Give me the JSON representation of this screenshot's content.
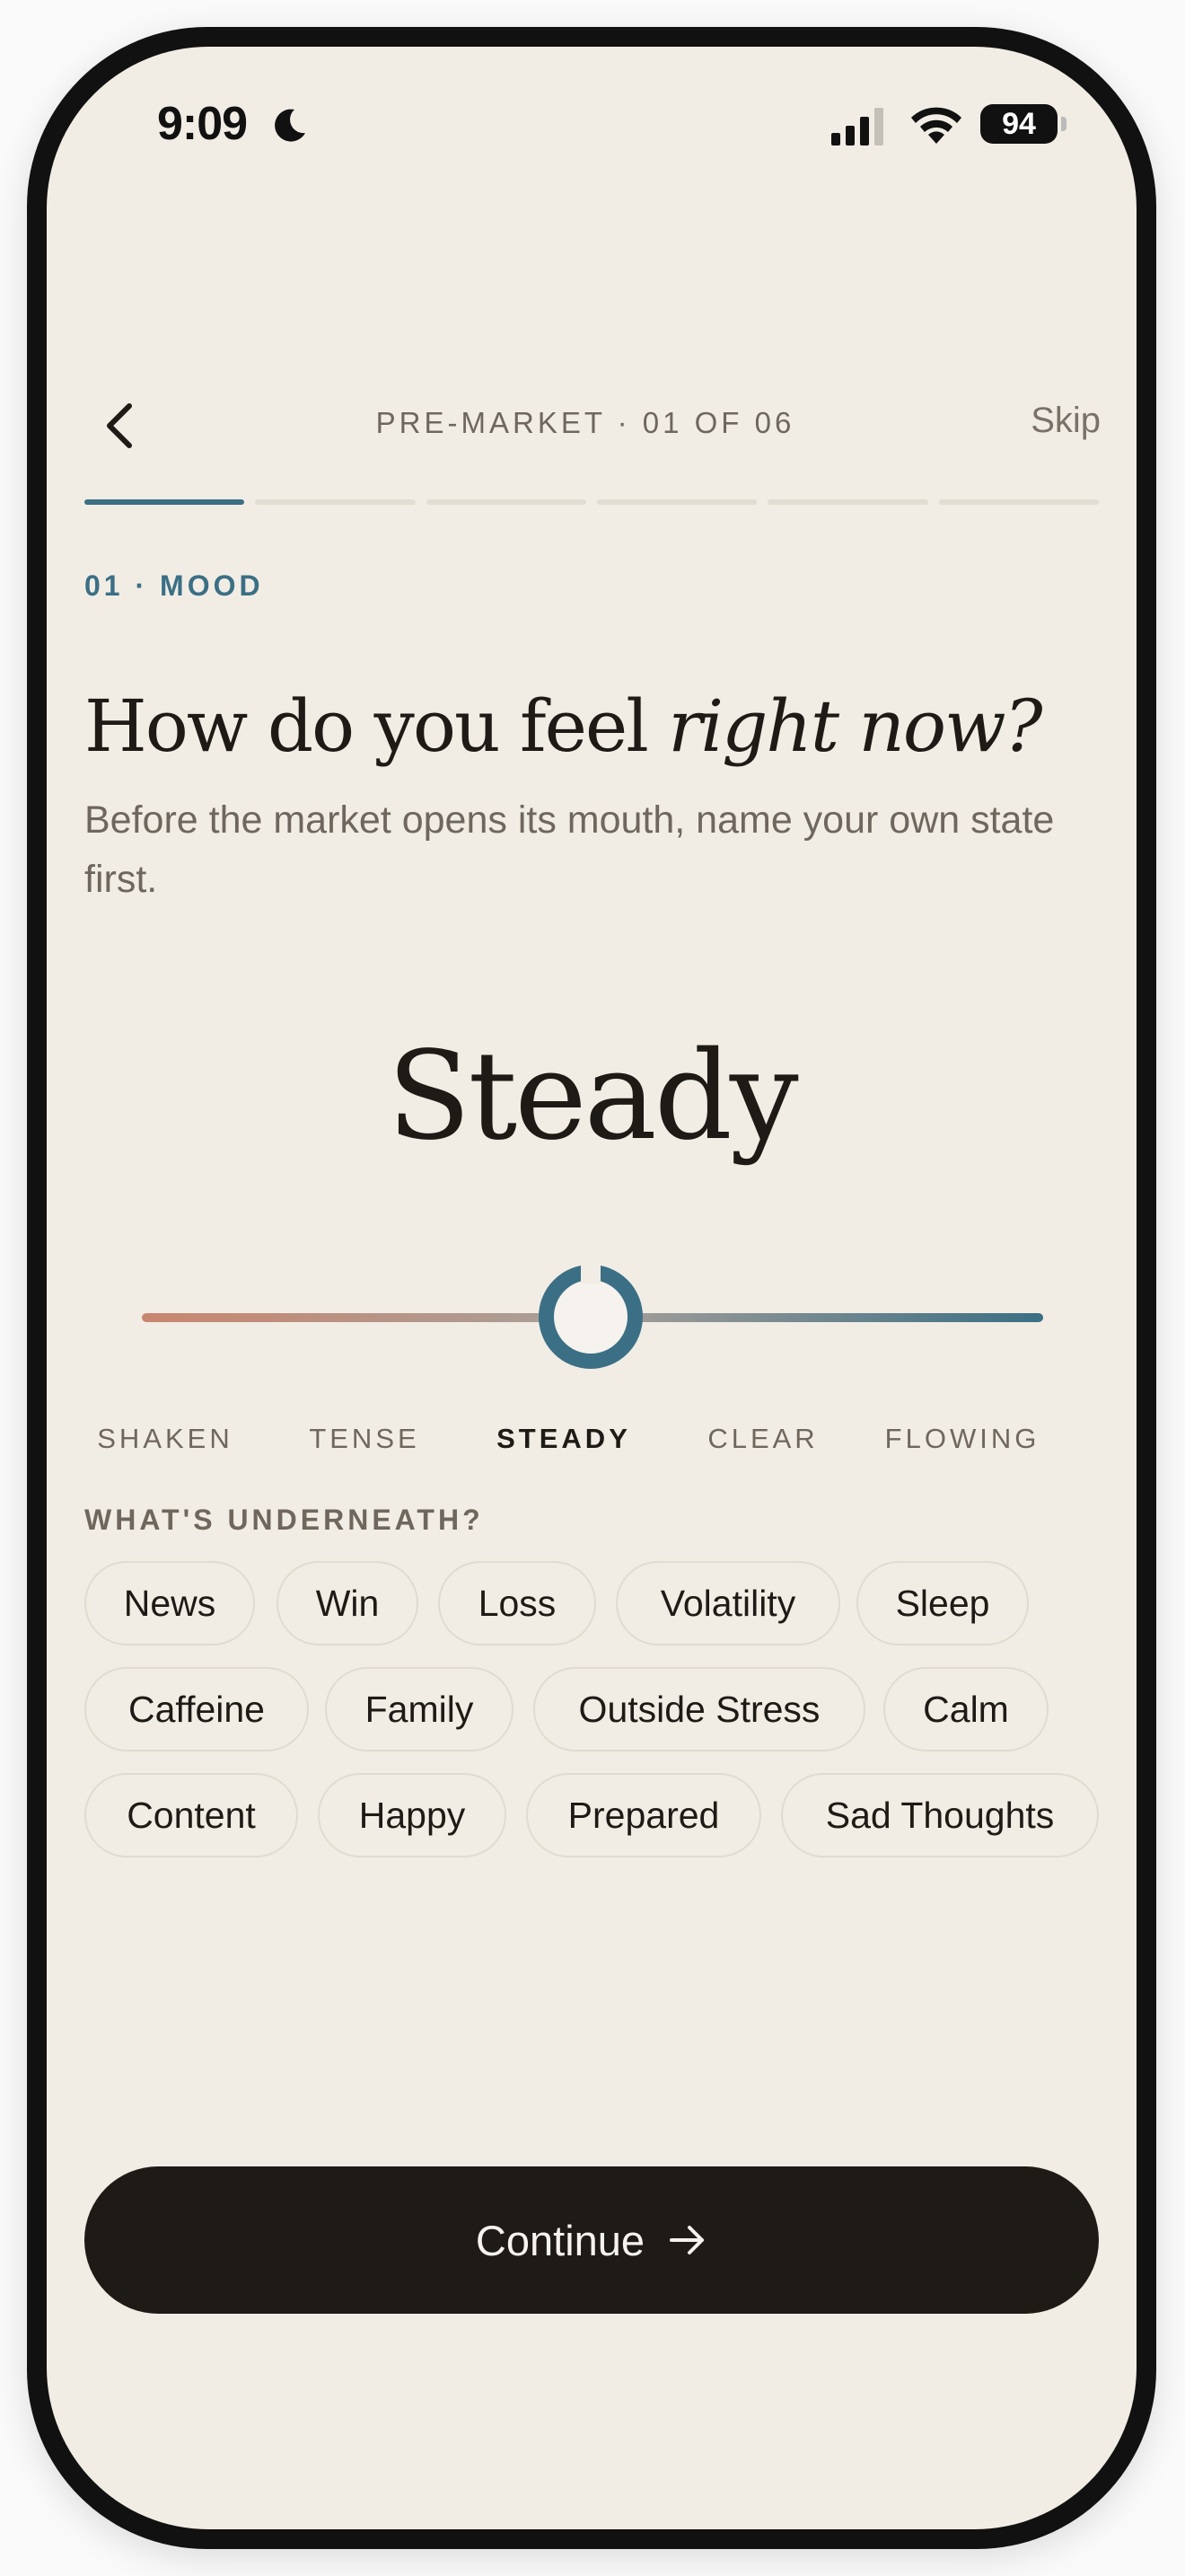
{
  "status_bar": {
    "time": "9:09",
    "battery": "94"
  },
  "header": {
    "step_label": "PRE-MARKET · 01 OF 06",
    "skip_label": "Skip",
    "progress": {
      "current_step": 1,
      "total_steps": 6
    }
  },
  "question": {
    "section_label": "01 · MOOD",
    "title_plain": "How do you feel ",
    "title_italic": "right now?",
    "subtitle": "Before the market opens its mouth, name your own state first."
  },
  "mood": {
    "selected": "Steady",
    "scale": [
      "SHAKEN",
      "TENSE",
      "STEADY",
      "CLEAR",
      "FLOWING"
    ],
    "selected_index": 2,
    "colors": {
      "warm_end": "#c9866f",
      "cool_end": "#3b6f85"
    }
  },
  "underneath": {
    "label": "WHAT'S UNDERNEATH?",
    "chips": [
      "News",
      "Win",
      "Loss",
      "Volatility",
      "Sleep",
      "Caffeine",
      "Family",
      "Outside Stress",
      "Calm",
      "Content",
      "Happy",
      "Prepared",
      "Sad Thoughts"
    ]
  },
  "footer": {
    "continue_label": "Continue"
  },
  "colors": {
    "background": "#f1ede5",
    "accent": "#3b6f85",
    "ink": "#1e1b16",
    "muted": "#6f675d"
  },
  "icons": {
    "back": "chevron-left-icon",
    "continue": "arrow-right-icon",
    "status": [
      "moon-icon",
      "cellular-signal-icon",
      "wifi-icon",
      "battery-icon"
    ]
  }
}
